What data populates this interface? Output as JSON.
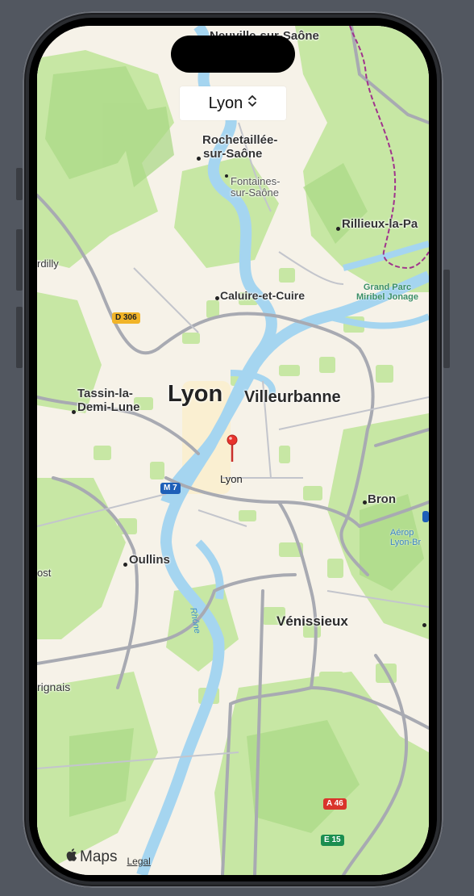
{
  "picker": {
    "selected": "Lyon",
    "icon": "chevron-up-down-icon"
  },
  "map": {
    "labels": {
      "neuville": "Neuville-sur-Saône",
      "rochetaillee_1": "Rochetaillée-",
      "rochetaillee_2": "sur-Saône",
      "fontaines_1": "Fontaines-",
      "fontaines_2": "sur-Saône",
      "rillieux": "Rillieux-la-Pa",
      "dilly": "rdilly",
      "grand_parc_1": "Grand Parc",
      "grand_parc_2": "Miribel Jonage",
      "caluire": "Caluire-et-Cuire",
      "tassin_1": "Tassin-la-",
      "tassin_2": "Demi-Lune",
      "lyon": "Lyon",
      "villeurbanne": "Villeurbanne",
      "bron": "Bron",
      "aeroport_1": "Aérop",
      "aeroport_2": "Lyon-Br",
      "oullins": "Oullins",
      "ost": "ost",
      "rhone": "Rhône",
      "venissieux": "Vénissieux",
      "rignais": "rignais"
    },
    "shields": {
      "d306": "D 306",
      "m7": "M 7",
      "a46": "A 46",
      "e15": "E 15"
    },
    "pin_label": "Lyon"
  },
  "attribution": {
    "maps": "Maps",
    "legal": "Legal"
  },
  "colors": {
    "land": "#f6f2e8",
    "green": "#c7e7a4",
    "green_dark": "#a9d884",
    "water": "#a5d5f0",
    "road": "#a8aab2",
    "pin": "#e8332d"
  }
}
